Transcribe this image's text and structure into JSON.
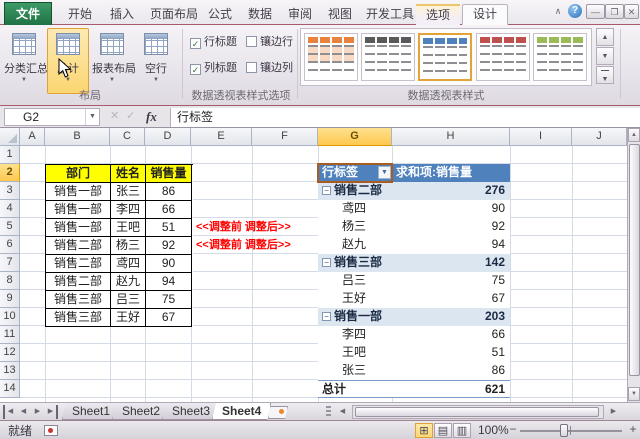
{
  "window": {
    "help": "?",
    "ribbon_collapse": "∧",
    "minimize": "—",
    "restore": "❐",
    "close": "✕"
  },
  "tabs": {
    "file": "文件",
    "main": [
      "开始",
      "插入",
      "页面布局",
      "公式",
      "数据",
      "审阅",
      "视图",
      "开发工具"
    ],
    "contextual": [
      "选项",
      "设计"
    ],
    "active": "设计"
  },
  "ribbon": {
    "layout": {
      "label": "布局",
      "buttons": [
        {
          "label": "分类汇总"
        },
        {
          "label": "总计"
        },
        {
          "label": "报表布局"
        },
        {
          "label": "空行"
        }
      ],
      "highlighted": "总计"
    },
    "style_options": {
      "label": "数据透视表样式选项",
      "checkboxes": [
        {
          "label": "行标题",
          "checked": true
        },
        {
          "label": "列标题",
          "checked": true
        },
        {
          "label": "镶边行",
          "checked": false
        },
        {
          "label": "镶边列",
          "checked": false
        }
      ]
    },
    "styles": {
      "label": "数据透视表样式",
      "colors": [
        "#e8823c",
        "#5a5a5a",
        "#4f81bd",
        "#c0504d",
        "#9bbb59"
      ],
      "selected_index": 2
    }
  },
  "formula_bar": {
    "name_box": "G2",
    "fx": "fx",
    "value": "行标签"
  },
  "grid": {
    "col_headers": [
      "A",
      "B",
      "C",
      "D",
      "E",
      "F",
      "G",
      "H",
      "I",
      "J"
    ],
    "row_headers": [
      "1",
      "2",
      "3",
      "4",
      "5",
      "6",
      "7",
      "8",
      "9",
      "10",
      "11",
      "12",
      "13",
      "14"
    ],
    "selected_cell": "G2"
  },
  "source_table": {
    "headers": [
      "部门",
      "姓名",
      "销售量"
    ],
    "rows": [
      [
        "销售一部",
        "张三",
        "86"
      ],
      [
        "销售一部",
        "李四",
        "66"
      ],
      [
        "销售一部",
        "王吧",
        "51"
      ],
      [
        "销售二部",
        "杨三",
        "92"
      ],
      [
        "销售二部",
        "鸢四",
        "90"
      ],
      [
        "销售二部",
        "赵九",
        "94"
      ],
      [
        "销售三部",
        "吕三",
        "75"
      ],
      [
        "销售三部",
        "王好",
        "67"
      ]
    ]
  },
  "annotations": {
    "line1": "<<调整前  调整后>>",
    "line2": "<<调整前  调整后>>",
    "color": "#ff0000"
  },
  "pivot": {
    "header": {
      "row_label": "行标签",
      "value_label": "求和项:销售量"
    },
    "header_color": "#4f81bd",
    "group_row_color": "#dce6f1",
    "rows": [
      {
        "label": "销售二部",
        "value": "276",
        "type": "group"
      },
      {
        "label": "鸢四",
        "value": "90",
        "type": "item"
      },
      {
        "label": "杨三",
        "value": "92",
        "type": "item"
      },
      {
        "label": "赵九",
        "value": "94",
        "type": "item"
      },
      {
        "label": "销售三部",
        "value": "142",
        "type": "group"
      },
      {
        "label": "吕三",
        "value": "75",
        "type": "item"
      },
      {
        "label": "王好",
        "value": "67",
        "type": "item"
      },
      {
        "label": "销售一部",
        "value": "203",
        "type": "group"
      },
      {
        "label": "李四",
        "value": "66",
        "type": "item"
      },
      {
        "label": "王吧",
        "value": "51",
        "type": "item"
      },
      {
        "label": "张三",
        "value": "86",
        "type": "item"
      },
      {
        "label": "总计",
        "value": "621",
        "type": "total"
      }
    ]
  },
  "sheet_bar": {
    "tabs": [
      "Sheet1",
      "Sheet2",
      "Sheet3",
      "Sheet4"
    ],
    "active": "Sheet4"
  },
  "status_bar": {
    "ready": "就绪",
    "zoom_level": "100%",
    "zoom_out": "−",
    "zoom_in": "+"
  },
  "icons": {
    "dropdown": "▼",
    "up": "▲",
    "down": "▼",
    "left": "◀",
    "right": "▶",
    "collapse": "−",
    "check": "✓",
    "view_normal": "⊞",
    "view_layout": "▤",
    "view_break": "▥"
  }
}
